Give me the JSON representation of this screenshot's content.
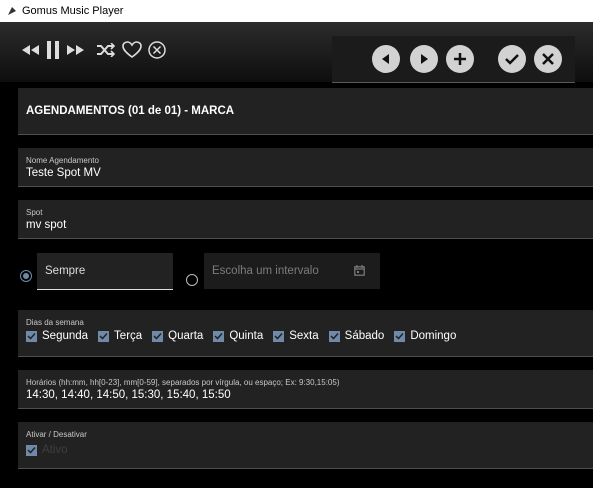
{
  "app": {
    "title": "Gomus Music Player"
  },
  "schedule": {
    "header": "AGENDAMENTOS (01 de 01) - MARCA",
    "name": {
      "label": "Nome Agendamento",
      "value": "Teste Spot MV"
    },
    "spot": {
      "label": "Spot",
      "value": "mv spot"
    },
    "mode": {
      "always_label": "Sempre",
      "interval_placeholder": "Escolha um intervalo"
    },
    "days": {
      "label": "Dias da semana",
      "items": [
        {
          "label": "Segunda",
          "checked": true
        },
        {
          "label": "Terça",
          "checked": true
        },
        {
          "label": "Quarta",
          "checked": true
        },
        {
          "label": "Quinta",
          "checked": true
        },
        {
          "label": "Sexta",
          "checked": true
        },
        {
          "label": "Sábado",
          "checked": true
        },
        {
          "label": "Domingo",
          "checked": true
        }
      ]
    },
    "times": {
      "label": "Horários (hh:mm, hh[0-23], mm[0-59], separados por vírgula, ou espaço; Ex: 9:30,15:05)",
      "value": "14:30, 14:40, 14:50, 15:30, 15:40, 15:50"
    },
    "activate": {
      "label": "Ativar / Desativar",
      "checkbox_label": "Ativo"
    }
  }
}
